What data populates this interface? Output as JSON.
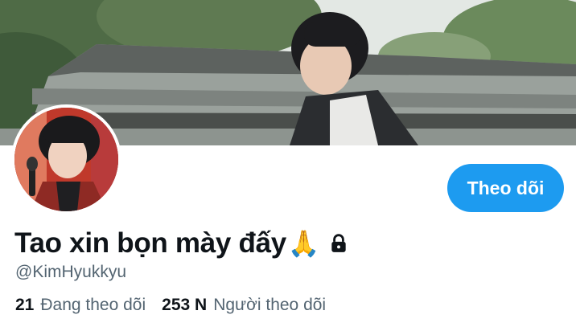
{
  "profile": {
    "display_name": "Tao xin bọn mày đấy",
    "name_emoji": "🙏",
    "handle": "@KimHyukkyu",
    "follow_button_label": "Theo dõi",
    "stats": {
      "following_count": "21",
      "following_label": "Đang theo dõi",
      "followers_count": "253 N",
      "followers_label": "Người theo dõi"
    }
  },
  "icons": {
    "lock": "lock-icon",
    "prayer": "folded-hands-emoji"
  },
  "colors": {
    "accent": "#1d9bf0",
    "text_primary": "#0f1419",
    "text_secondary": "#536471",
    "background": "#ffffff"
  }
}
